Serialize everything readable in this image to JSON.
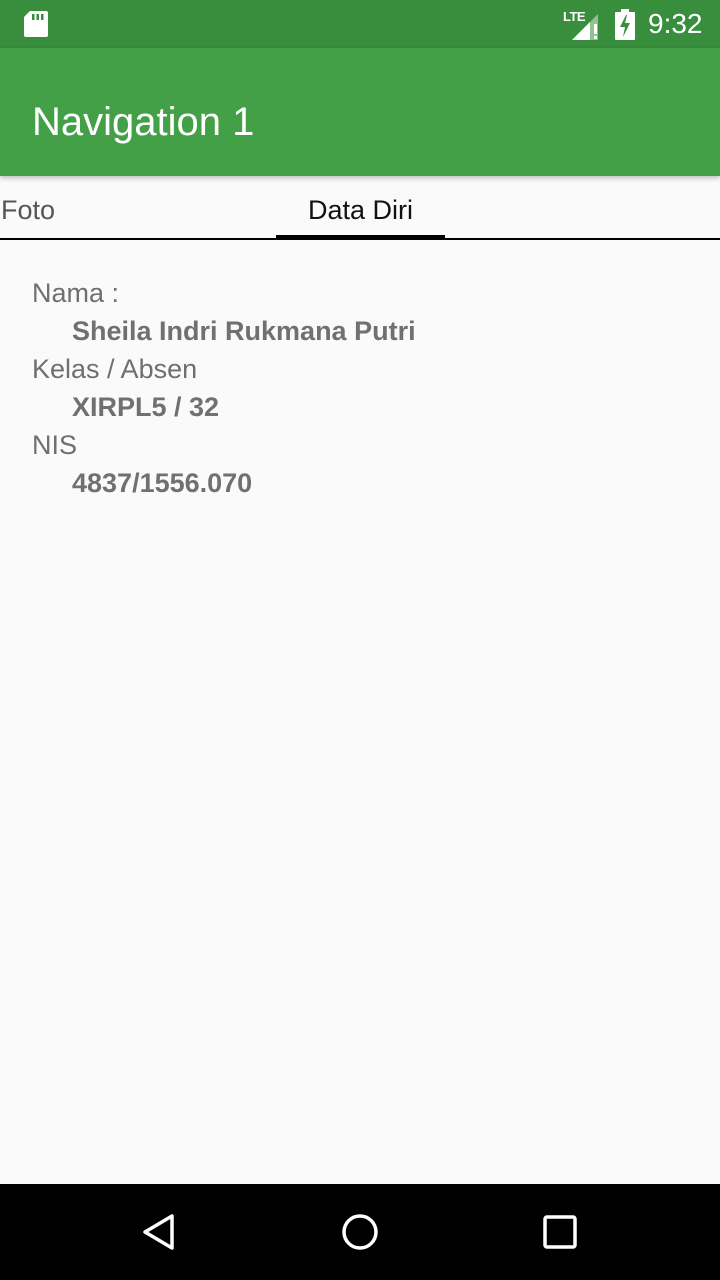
{
  "status_bar": {
    "network": "LTE",
    "time": "9:32",
    "icons": [
      "sd-card-icon",
      "signal-icon",
      "battery-charging-icon"
    ]
  },
  "app_bar": {
    "title": "Navigation 1",
    "color": "#43a047"
  },
  "tabs": [
    {
      "label": "Foto",
      "selected": false
    },
    {
      "label": "Data Diri",
      "selected": true
    }
  ],
  "profile": {
    "name_label": "Nama :",
    "name_value": "Sheila Indri Rukmana Putri",
    "class_label": "Kelas / Absen",
    "class_value": "XIRPL5 / 32",
    "nis_label": "NIS",
    "nis_value": "4837/1556.070"
  },
  "nav_bar": {
    "icons": [
      "back-icon",
      "home-icon",
      "recents-icon"
    ]
  }
}
